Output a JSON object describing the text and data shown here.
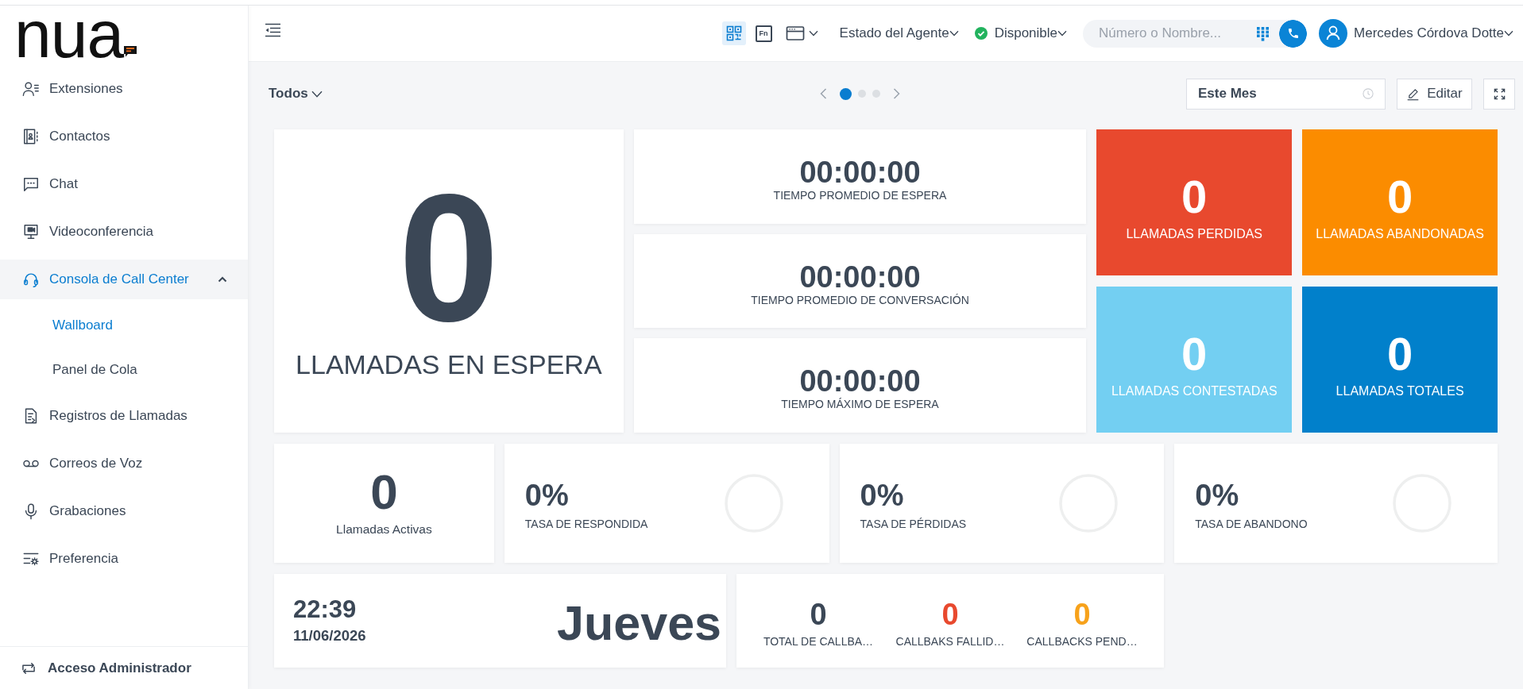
{
  "sidebar": {
    "logo": "nua",
    "items": [
      {
        "label": "Extensiones",
        "selected": false
      },
      {
        "label": "Contactos",
        "selected": false
      },
      {
        "label": "Chat",
        "selected": false
      },
      {
        "label": "Videoconferencia",
        "selected": false
      },
      {
        "label": "Consola de Call Center",
        "selected": true,
        "expanded": true,
        "children": [
          {
            "label": "Wallboard",
            "selected": true
          },
          {
            "label": "Panel de Cola",
            "selected": false
          }
        ]
      },
      {
        "label": "Registros de Llamadas",
        "selected": false
      },
      {
        "label": "Correos de Voz",
        "selected": false
      },
      {
        "label": "Grabaciones",
        "selected": false
      },
      {
        "label": "Preferencia",
        "selected": false
      }
    ],
    "footer": {
      "label": "Acceso Administrador"
    }
  },
  "header": {
    "view_buttons": [
      {
        "selected": true
      },
      {
        "label": "Fn",
        "selected": false
      },
      {
        "selected": false
      }
    ],
    "agent_state": {
      "label": "Estado del Agente"
    },
    "status": {
      "label": "Disponible"
    },
    "search": {
      "placeholder": "Número o Nombre..."
    },
    "user": {
      "name": "Mercedes Córdova Dotte"
    }
  },
  "toolbar": {
    "filter": {
      "label": "Todos"
    },
    "pages": [
      {
        "selected": true
      },
      {
        "selected": false
      },
      {
        "selected": false
      }
    ],
    "period": {
      "value": "Este Mes"
    },
    "edit_button": {
      "label": "Editar"
    }
  },
  "dashboard": {
    "waiting": {
      "value": "0",
      "label": "LLAMADAS EN ESPERA"
    },
    "times": [
      {
        "value": "00:00:00",
        "label": "TIEMPO PROMEDIO DE ESPERA"
      },
      {
        "value": "00:00:00",
        "label": "TIEMPO PROMEDIO DE CONVERSACIÓN"
      },
      {
        "value": "00:00:00",
        "label": "TIEMPO MÁXIMO DE ESPERA"
      }
    ],
    "tiles": [
      {
        "value": "0",
        "label": "LLAMADAS PERDIDAS",
        "color": "#e8492e"
      },
      {
        "value": "0",
        "label": "LLAMADAS ABANDONADAS",
        "color": "#fb8c00"
      },
      {
        "value": "0",
        "label": "LLAMADAS CONTESTADAS",
        "color": "#73cff2"
      },
      {
        "value": "0",
        "label": "LLAMADAS TOTALES",
        "color": "#0180cb"
      }
    ],
    "active_calls": {
      "value": "0",
      "label": "Llamadas Activas"
    },
    "rates": [
      {
        "value": "0%",
        "label": "TASA DE RESPONDIDA"
      },
      {
        "value": "0%",
        "label": "TASA DE PÉRDIDAS"
      },
      {
        "value": "0%",
        "label": "TASA DE ABANDONO"
      }
    ],
    "clock": {
      "time": "22:39",
      "date": "11/06/2026",
      "day": "Jueves"
    },
    "callbacks": [
      {
        "value": "0",
        "label": "TOTAL DE CALLBA…",
        "color": "#3b4756"
      },
      {
        "value": "0",
        "label": "CALLBAKS FALLID…",
        "color": "#e8492e"
      },
      {
        "value": "0",
        "label": "CALLBACKS PEND…",
        "color": "#f7a21b"
      }
    ]
  }
}
